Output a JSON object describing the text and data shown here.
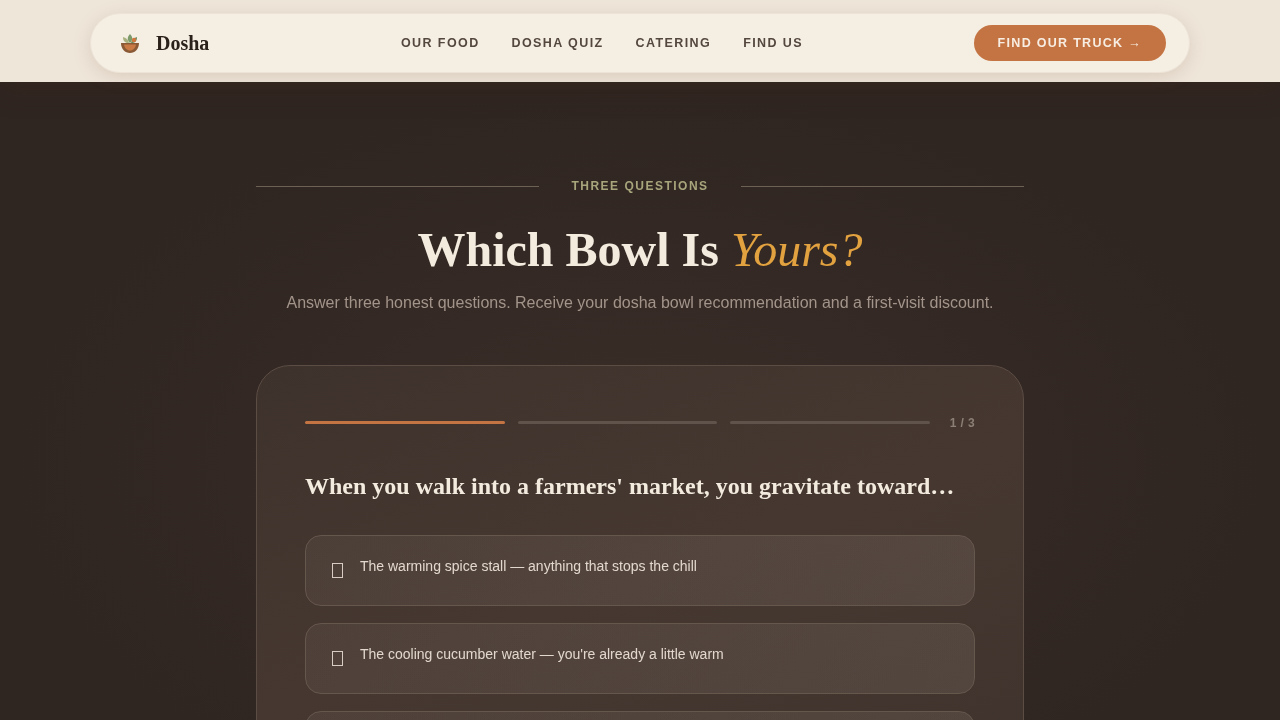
{
  "nav": {
    "brand": "Dosha",
    "links": [
      "OUR FOOD",
      "DOSHA QUIZ",
      "CATERING",
      "FIND US"
    ],
    "cta": "FIND OUR TRUCK →"
  },
  "hero": {
    "eyebrow": "THREE QUESTIONS",
    "title": "Which Bowl Is *Yours?*",
    "subtitle": "Answer three honest questions. Receive your dosha bowl recommendation and a first-visit discount."
  },
  "quiz": {
    "progress": {
      "steps": [
        {
          "done": true
        },
        {
          "done": false
        },
        {
          "done": false
        }
      ],
      "reading": "1 / 3"
    },
    "question": "When you walk into a farmers' market, you gravitate toward…",
    "options": [
      {
        "kind": "answer",
        "text": "The warming spice stall — anything that stops the chill"
      },
      {
        "kind": "answer",
        "text": "The cooling cucumber water — you're already a little warm"
      },
      {
        "kind": "cut-off"
      }
    ]
  }
}
